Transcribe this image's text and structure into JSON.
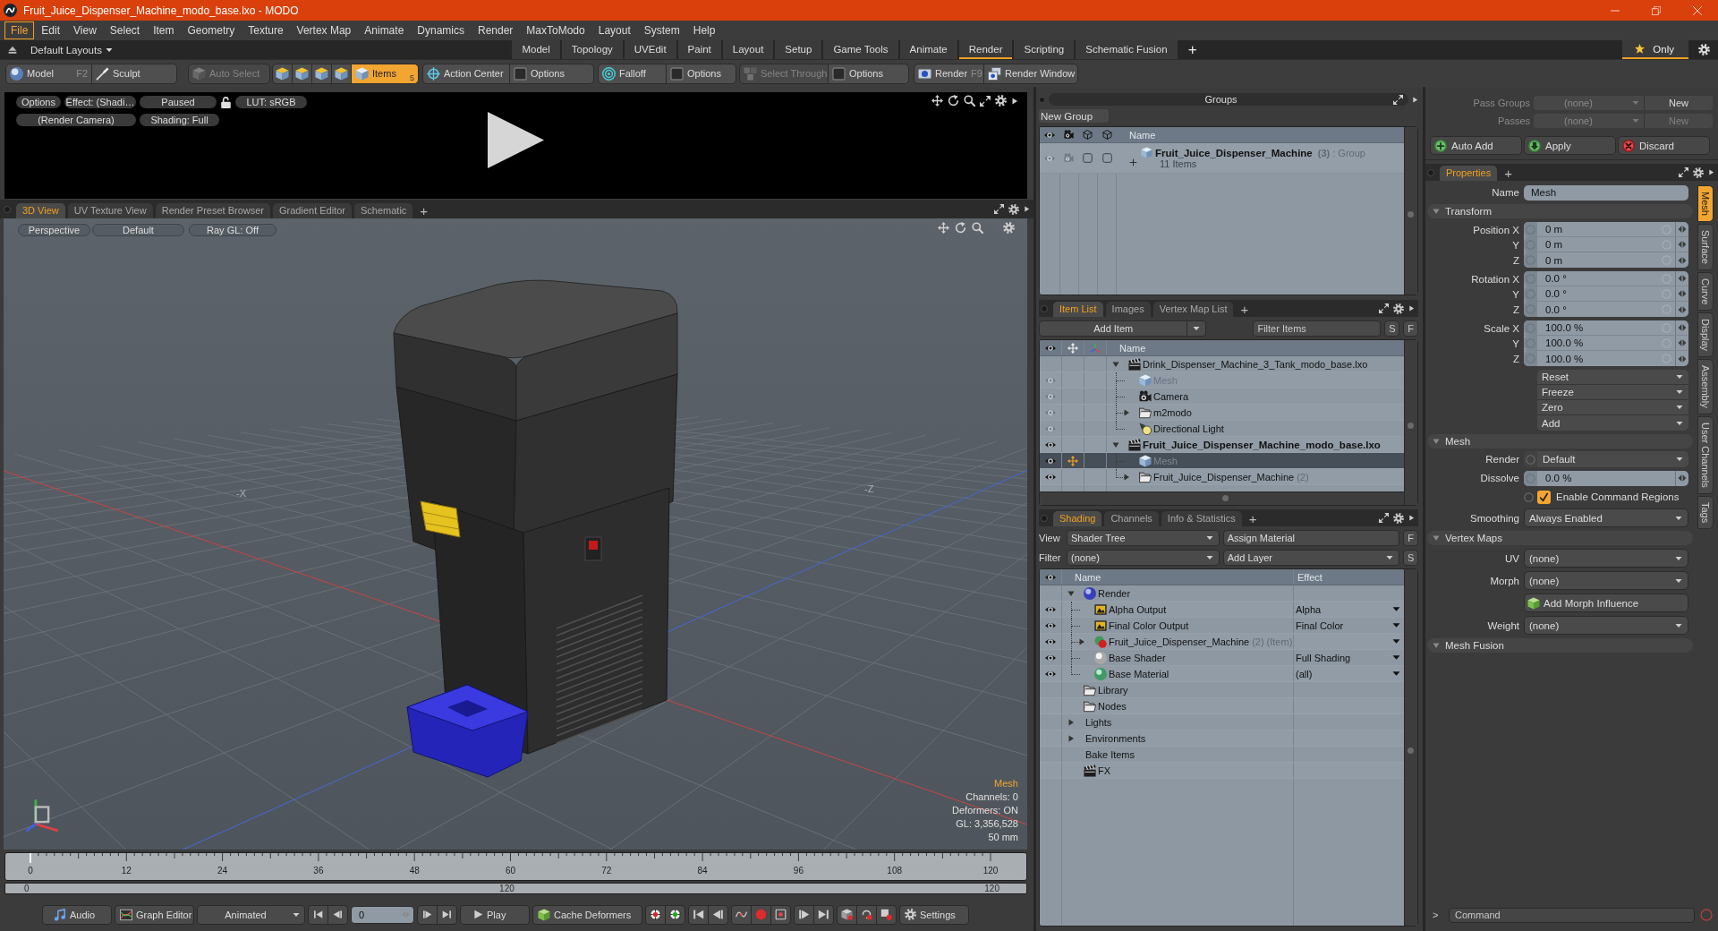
{
  "window": {
    "title": "Fruit_Juice_Dispenser_Machine_modo_base.lxo - MODO"
  },
  "menu": [
    {
      "label": "File",
      "selected": true
    },
    {
      "label": "Edit",
      "selected": false
    },
    {
      "label": "View",
      "selected": false
    },
    {
      "label": "Select",
      "selected": false
    },
    {
      "label": "Item",
      "selected": false
    },
    {
      "label": "Geometry",
      "selected": false
    },
    {
      "label": "Texture",
      "selected": false
    },
    {
      "label": "Vertex Map",
      "selected": false
    },
    {
      "label": "Animate",
      "selected": false
    },
    {
      "label": "Dynamics",
      "selected": false
    },
    {
      "label": "Render",
      "selected": false
    },
    {
      "label": "MaxToModo",
      "selected": false
    },
    {
      "label": "Layout",
      "selected": false
    },
    {
      "label": "System",
      "selected": false
    },
    {
      "label": "Help",
      "selected": false
    }
  ],
  "layouts": {
    "label": "Default Layouts",
    "tabs": [
      {
        "label": "Model",
        "selected": false
      },
      {
        "label": "Topology",
        "selected": false
      },
      {
        "label": "UVEdit",
        "selected": false
      },
      {
        "label": "Paint",
        "selected": false
      },
      {
        "label": "Layout",
        "selected": false
      },
      {
        "label": "Setup",
        "selected": false
      },
      {
        "label": "Game Tools",
        "selected": false
      },
      {
        "label": "Animate",
        "selected": false
      },
      {
        "label": "Render",
        "selected": true
      },
      {
        "label": "Scripting",
        "selected": false
      },
      {
        "label": "Schematic Fusion",
        "selected": false
      }
    ],
    "add": "+",
    "only": {
      "label": "Only",
      "selected": true
    }
  },
  "toolbar": [
    {
      "items": [
        {
          "label": "Model",
          "shortcut": "F2",
          "selected": false,
          "disabled": false
        },
        {
          "label": "Sculpt",
          "selected": false,
          "disabled": false
        }
      ]
    },
    {
      "items": [
        {
          "label": "Auto Select",
          "selected": false,
          "disabled": true
        }
      ]
    },
    {
      "items": [
        {
          "selected": false,
          "disabled": false
        },
        {
          "selected": false,
          "disabled": false
        },
        {
          "selected": false,
          "disabled": false
        },
        {
          "selected": false,
          "disabled": false
        },
        {
          "label": "Items",
          "shortcut": "5",
          "selected": true,
          "disabled": false
        }
      ]
    },
    {
      "items": [
        {
          "label": "Action Center",
          "selected": false,
          "disabled": false
        },
        {
          "label": "Options",
          "selected": false,
          "disabled": false
        }
      ]
    },
    {
      "items": [
        {
          "label": "Falloff",
          "selected": false,
          "disabled": false
        },
        {
          "label": "Options",
          "selected": false,
          "disabled": false
        }
      ]
    },
    {
      "items": [
        {
          "label": "Select Through",
          "selected": false,
          "disabled": true
        },
        {
          "label": "Options",
          "selected": false,
          "disabled": false
        }
      ]
    },
    {
      "items": [
        {
          "label": "Render",
          "shortcut": "F9",
          "selected": false,
          "disabled": false
        },
        {
          "label": "Render Window",
          "selected": false,
          "disabled": false
        }
      ]
    }
  ],
  "preview": {
    "row_1": [
      "Options",
      "Effect: (Shadi…",
      "Paused"
    ],
    "lut": "LUT: sRGB",
    "row_2": [
      "(Render Camera)",
      "Shading: Full"
    ]
  },
  "viewport_tabs": {
    "tabs": [
      {
        "label": "3D View",
        "selected": true
      },
      {
        "label": "UV Texture View",
        "selected": false
      },
      {
        "label": "Render Preset Browser",
        "selected": false
      },
      {
        "label": "Gradient Editor",
        "selected": false
      },
      {
        "label": "Schematic",
        "selected": false
      }
    ],
    "add": "+"
  },
  "viewport": {
    "buttons": [
      "Perspective",
      "Default",
      "Ray GL: Off"
    ],
    "axis_labels": [
      "-X",
      "-Z"
    ],
    "info_title": "Mesh",
    "info": [
      "Channels: 0",
      "Deformers: ON",
      "GL: 3,356,528",
      "50 mm"
    ]
  },
  "timeline": {
    "ticks": [
      "0",
      "12",
      "24",
      "36",
      "48",
      "60",
      "72",
      "84",
      "96",
      "108",
      "120"
    ],
    "range": [
      "0",
      "120",
      "120"
    ]
  },
  "transport": {
    "audio": "Audio",
    "graph_editor": "Graph Editor",
    "mode": "Animated",
    "frame": "0",
    "play": "Play",
    "cache": "Cache Deformers",
    "settings": "Settings"
  },
  "groups": {
    "title": "Groups",
    "new_group": "New Group",
    "column": "Name",
    "rows": [
      {
        "name": "Fruit_Juice_Dispenser_Machine",
        "count": "(3)",
        "type": ": Group",
        "items": "11 Items"
      }
    ]
  },
  "passes": {
    "rows": [
      {
        "label": "Pass Groups",
        "value": "(none)",
        "button": "New",
        "disabled": false
      },
      {
        "label": "Passes",
        "value": "(none)",
        "button": "New",
        "disabled": true
      }
    ],
    "actions": [
      "Auto Add",
      "Apply",
      "Discard"
    ]
  },
  "item_list": {
    "tabs": [
      {
        "label": "Item List",
        "selected": true
      },
      {
        "label": "Images",
        "selected": false
      },
      {
        "label": "Vertex Map List",
        "selected": false
      }
    ],
    "add": "+",
    "add_item": "Add Item",
    "filter_placeholder": "Filter Items",
    "buttons": [
      "S",
      "F"
    ],
    "column": "Name",
    "tree": [
      {
        "kind": "scene",
        "name": "Drink_Dispenser_Machine_3_Tank_modo_base.lxo",
        "active": false,
        "visible": false,
        "selected": false,
        "expanded": true,
        "children": [
          {
            "kind": "mesh",
            "name": "Mesh",
            "visible": true,
            "dimmed": true,
            "selected": false
          },
          {
            "kind": "camera",
            "name": "Camera",
            "visible": true,
            "dimmed": false,
            "selected": false
          },
          {
            "kind": "group",
            "name": "m2modo",
            "visible": true,
            "dimmed": false,
            "selected": false,
            "expanded": false
          },
          {
            "kind": "light",
            "name": "Directional Light",
            "visible": true,
            "dimmed": false,
            "selected": false
          }
        ]
      },
      {
        "kind": "scene",
        "name": "Fruit_Juice_Dispenser_Machine_modo_base.lxo",
        "active": true,
        "visible": true,
        "selected": false,
        "expanded": true,
        "children": [
          {
            "kind": "mesh",
            "name": "Mesh",
            "visible": true,
            "dimmed": true,
            "selected": true
          },
          {
            "kind": "group",
            "name": "Fruit_Juice_Dispenser_Machine",
            "count": "(2)",
            "visible": true,
            "dimmed": false,
            "selected": false,
            "expanded": false
          }
        ]
      }
    ]
  },
  "shading": {
    "tabs": [
      {
        "label": "Shading",
        "selected": true
      },
      {
        "label": "Channels",
        "selected": false
      },
      {
        "label": "Info & Statistics",
        "selected": false
      }
    ],
    "add": "+",
    "view_label": "View",
    "view": "Shader Tree",
    "assign": "Assign Material",
    "filter_label": "Filter",
    "filter": "(none)",
    "add_layer": "Add Layer",
    "buttons": [
      "F",
      "S"
    ],
    "columns": [
      "Name",
      "Effect"
    ],
    "tree": [
      {
        "kind": "render",
        "name": "Render",
        "expanded": true,
        "children": [
          {
            "kind": "output",
            "name": "Alpha Output",
            "effect": "Alpha",
            "visible": true
          },
          {
            "kind": "output",
            "name": "Final Color Output",
            "effect": "Final Color",
            "visible": true
          },
          {
            "kind": "mask",
            "name": "Fruit_Juice_Dispenser_Machine",
            "count": "(2)",
            "note": "(Item)",
            "visible": true,
            "expanded": false
          },
          {
            "kind": "shader",
            "name": "Base Shader",
            "effect": "Full Shading",
            "visible": true
          },
          {
            "kind": "material",
            "name": "Base Material",
            "effect": "(all)",
            "visible": true
          }
        ]
      },
      {
        "kind": "folder",
        "name": "Library"
      },
      {
        "kind": "folder",
        "name": "Nodes"
      },
      {
        "kind": "category",
        "name": "Lights",
        "expanded": false
      },
      {
        "kind": "category",
        "name": "Environments",
        "expanded": false
      },
      {
        "kind": "category",
        "name": "Bake Items"
      },
      {
        "kind": "fx",
        "name": "FX"
      }
    ]
  },
  "properties": {
    "tabs": [
      {
        "label": "Properties",
        "selected": true
      }
    ],
    "add": "+",
    "name_label": "Name",
    "name_value": "Mesh",
    "side_tabs": [
      {
        "label": "Mesh",
        "selected": true
      },
      {
        "label": "Surface",
        "selected": false
      },
      {
        "label": "Curve",
        "selected": false
      },
      {
        "label": "Display",
        "selected": false
      },
      {
        "label": "Assembly",
        "selected": false
      },
      {
        "label": "User Channels",
        "selected": false
      },
      {
        "label": "Tags",
        "selected": false
      }
    ],
    "sections": [
      {
        "title": "Transform",
        "expanded": true,
        "rows": [
          {
            "kind": "vector",
            "fields": [
              {
                "label": "Position X",
                "value": "0 m"
              },
              {
                "label": "Y",
                "value": "0 m"
              },
              {
                "label": "Z",
                "value": "0 m"
              }
            ]
          },
          {
            "kind": "vector",
            "fields": [
              {
                "label": "Rotation X",
                "value": "0.0 °"
              },
              {
                "label": "Y",
                "value": "0.0 °"
              },
              {
                "label": "Z",
                "value": "0.0 °"
              }
            ]
          },
          {
            "kind": "vector",
            "fields": [
              {
                "label": "Scale X",
                "value": "100.0 %"
              },
              {
                "label": "Y",
                "value": "100.0 %"
              },
              {
                "label": "Z",
                "value": "100.0 %"
              }
            ]
          },
          {
            "kind": "menus",
            "items": [
              "Reset",
              "Freeze",
              "Zero",
              "Add"
            ]
          }
        ]
      },
      {
        "title": "Mesh",
        "expanded": true,
        "rows": [
          {
            "kind": "channel_dropdown",
            "label": "Render",
            "value": "Default"
          },
          {
            "kind": "number",
            "label": "Dissolve",
            "value": "0.0 %"
          },
          {
            "kind": "check",
            "label": "Enable Command Regions",
            "checked": true
          },
          {
            "kind": "dropdown",
            "label": "Smoothing",
            "value": "Always Enabled"
          }
        ]
      },
      {
        "title": "Vertex Maps",
        "expanded": true,
        "rows": [
          {
            "kind": "dropdown",
            "label": "UV",
            "value": "(none)"
          },
          {
            "kind": "dropdown",
            "label": "Morph",
            "value": "(none)"
          },
          {
            "kind": "button",
            "label": "Add Morph Influence"
          },
          {
            "kind": "dropdown",
            "label": "Weight",
            "value": "(none)"
          }
        ]
      },
      {
        "title": "Mesh Fusion",
        "expanded": true
      }
    ]
  },
  "command": {
    "prompt": ">",
    "placeholder": "Command"
  }
}
